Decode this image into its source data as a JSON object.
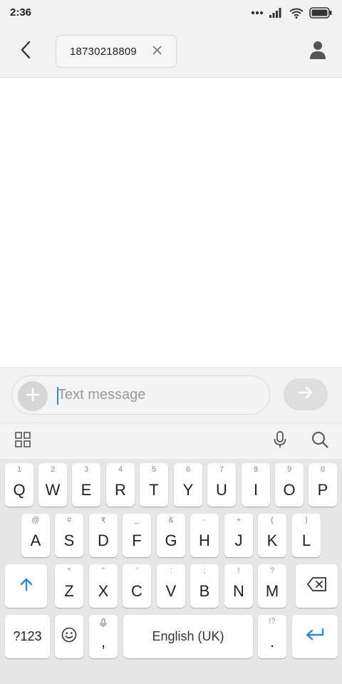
{
  "status_bar": {
    "time": "2:36",
    "icons": [
      "more-dots-icon",
      "signal-icon",
      "wifi-icon",
      "battery-icon"
    ]
  },
  "header": {
    "back_icon": "chevron-left-icon",
    "recipient": "18730218809",
    "remove_icon": "close-icon",
    "contact_icon": "person-icon"
  },
  "composer": {
    "placeholder": "Text message",
    "value": "",
    "add_icon": "plus-icon",
    "send_icon": "arrow-right-icon"
  },
  "keyboard_toolbar": {
    "icons": [
      "grid-icon",
      "microphone-icon",
      "search-icon"
    ]
  },
  "keyboard": {
    "row1": [
      {
        "key": "Q",
        "hint": "1"
      },
      {
        "key": "W",
        "hint": "2"
      },
      {
        "key": "E",
        "hint": "3"
      },
      {
        "key": "R",
        "hint": "4"
      },
      {
        "key": "T",
        "hint": "5"
      },
      {
        "key": "Y",
        "hint": "6"
      },
      {
        "key": "U",
        "hint": "7"
      },
      {
        "key": "I",
        "hint": "8"
      },
      {
        "key": "O",
        "hint": "9"
      },
      {
        "key": "P",
        "hint": "0"
      }
    ],
    "row2": [
      {
        "key": "A",
        "hint": "@"
      },
      {
        "key": "S",
        "hint": "#"
      },
      {
        "key": "D",
        "hint": "₹"
      },
      {
        "key": "F",
        "hint": "_"
      },
      {
        "key": "G",
        "hint": "&"
      },
      {
        "key": "H",
        "hint": "-"
      },
      {
        "key": "J",
        "hint": "+"
      },
      {
        "key": "K",
        "hint": "("
      },
      {
        "key": "L",
        "hint": ")"
      }
    ],
    "row3": [
      {
        "key": "Z",
        "hint": "*"
      },
      {
        "key": "X",
        "hint": "\""
      },
      {
        "key": "C",
        "hint": "'"
      },
      {
        "key": "V",
        "hint": ":"
      },
      {
        "key": "B",
        "hint": ";"
      },
      {
        "key": "N",
        "hint": "!"
      },
      {
        "key": "M",
        "hint": "?"
      }
    ],
    "shift_icon": "shift-arrow-icon",
    "backspace_icon": "backspace-icon",
    "symbols_label": "?123",
    "emoji_icon": "smiley-icon",
    "comma": {
      "key": ",",
      "hint_icon": "microphone-icon"
    },
    "space_label": "English (UK)",
    "period": {
      "key": ".",
      "hint": "!?"
    },
    "enter_icon": "enter-arrow-icon",
    "accent_color": "#2e8ad8"
  }
}
